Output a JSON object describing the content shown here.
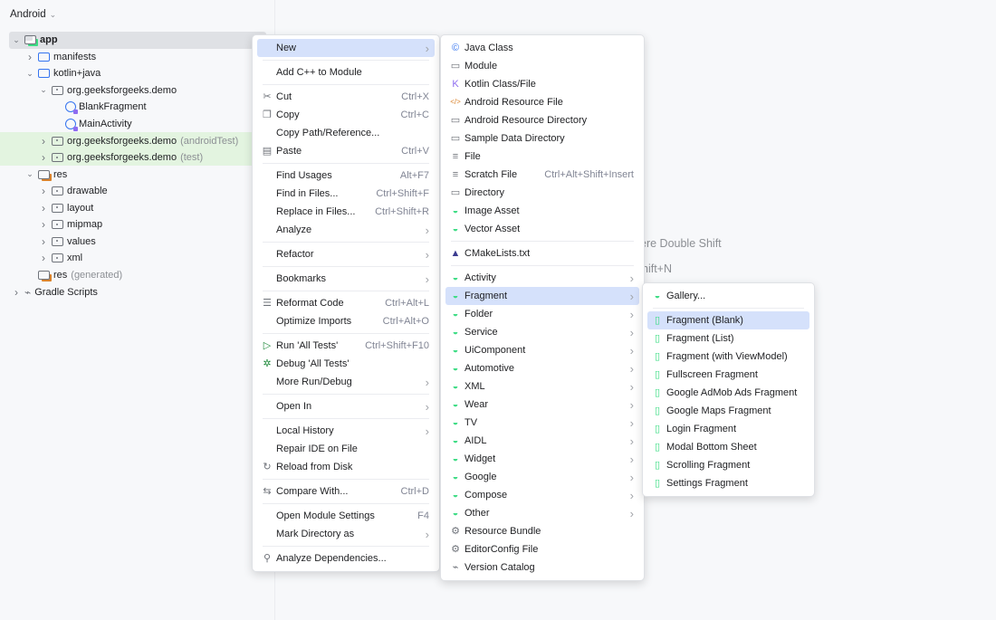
{
  "project_view": {
    "selector": "Android",
    "tree": [
      {
        "label": "app",
        "depth": 0,
        "arrow": "open",
        "icon": "module-folder-icon",
        "selected": true
      },
      {
        "label": "manifests",
        "depth": 1,
        "arrow": "closed",
        "icon": "folder-icon"
      },
      {
        "label": "kotlin+java",
        "depth": 1,
        "arrow": "open",
        "icon": "folder-icon"
      },
      {
        "label": "org.geeksforgeeks.demo",
        "depth": 2,
        "arrow": "open",
        "icon": "package-icon"
      },
      {
        "label": "BlankFragment",
        "depth": 3,
        "arrow": "none",
        "icon": "kotlin-class-icon"
      },
      {
        "label": "MainActivity",
        "depth": 3,
        "arrow": "none",
        "icon": "kotlin-class-icon"
      },
      {
        "label": "org.geeksforgeeks.demo",
        "suffix": "(androidTest)",
        "depth": 2,
        "arrow": "closed",
        "icon": "package-icon",
        "green": true
      },
      {
        "label": "org.geeksforgeeks.demo",
        "suffix": "(test)",
        "depth": 2,
        "arrow": "closed",
        "icon": "package-icon",
        "green": true
      },
      {
        "label": "res",
        "depth": 1,
        "arrow": "open",
        "icon": "res-folder-icon"
      },
      {
        "label": "drawable",
        "depth": 2,
        "arrow": "closed",
        "icon": "package-icon"
      },
      {
        "label": "layout",
        "depth": 2,
        "arrow": "closed",
        "icon": "package-icon"
      },
      {
        "label": "mipmap",
        "depth": 2,
        "arrow": "closed",
        "icon": "package-icon"
      },
      {
        "label": "values",
        "depth": 2,
        "arrow": "closed",
        "icon": "package-icon"
      },
      {
        "label": "xml",
        "depth": 2,
        "arrow": "closed",
        "icon": "package-icon"
      },
      {
        "label": "res",
        "suffix": "(generated)",
        "depth": 1,
        "arrow": "none",
        "icon": "res-folder-icon"
      },
      {
        "label": "Gradle Scripts",
        "depth": 0,
        "arrow": "closed",
        "icon": "gradle-icon"
      }
    ]
  },
  "hints": [
    "ere Double Shift",
    "hift+N"
  ],
  "context_menu": [
    {
      "label": "New",
      "sub": true,
      "hl": true
    },
    "-",
    {
      "label": "Add C++ to Module"
    },
    "-",
    {
      "label": "Cut",
      "sc": "Ctrl+X",
      "icon": "scissors-icon",
      "g": "✂"
    },
    {
      "label": "Copy",
      "sc": "Ctrl+C",
      "icon": "copy-icon",
      "g": "❐"
    },
    {
      "label": "Copy Path/Reference..."
    },
    {
      "label": "Paste",
      "sc": "Ctrl+V",
      "icon": "paste-icon",
      "g": "▤"
    },
    "-",
    {
      "label": "Find Usages",
      "sc": "Alt+F7"
    },
    {
      "label": "Find in Files...",
      "sc": "Ctrl+Shift+F"
    },
    {
      "label": "Replace in Files...",
      "sc": "Ctrl+Shift+R"
    },
    {
      "label": "Analyze",
      "sub": true
    },
    "-",
    {
      "label": "Refactor",
      "sub": true
    },
    "-",
    {
      "label": "Bookmarks",
      "sub": true
    },
    "-",
    {
      "label": "Reformat Code",
      "sc": "Ctrl+Alt+L",
      "icon": "reformat-icon",
      "g": "☰"
    },
    {
      "label": "Optimize Imports",
      "sc": "Ctrl+Alt+O"
    },
    "-",
    {
      "label": "Run 'All Tests'",
      "sc": "Ctrl+Shift+F10",
      "icon": "run-icon",
      "g": "▷",
      "c": "#208a3c"
    },
    {
      "label": "Debug 'All Tests'",
      "icon": "debug-icon",
      "g": "✲",
      "c": "#208a3c"
    },
    {
      "label": "More Run/Debug",
      "sub": true
    },
    "-",
    {
      "label": "Open In",
      "sub": true
    },
    "-",
    {
      "label": "Local History",
      "sub": true
    },
    {
      "label": "Repair IDE on File"
    },
    {
      "label": "Reload from Disk",
      "icon": "reload-icon",
      "g": "↻"
    },
    "-",
    {
      "label": "Compare With...",
      "sc": "Ctrl+D",
      "icon": "compare-icon",
      "g": "⇆"
    },
    "-",
    {
      "label": "Open Module Settings",
      "sc": "F4"
    },
    {
      "label": "Mark Directory as",
      "sub": true
    },
    "-",
    {
      "label": "Analyze Dependencies...",
      "icon": "dependencies-icon",
      "g": "⚲"
    }
  ],
  "new_menu": [
    {
      "label": "Java Class",
      "icon": "java-class-icon",
      "g": "©",
      "c": "#3574f0"
    },
    {
      "label": "Module",
      "icon": "module-icon",
      "g": "▭"
    },
    {
      "label": "Kotlin Class/File",
      "icon": "kotlin-icon",
      "g": "K",
      "c": "#8e6cf0"
    },
    {
      "label": "Android Resource File",
      "icon": "xml-file-icon",
      "g": "</>",
      "c": "#d9822b"
    },
    {
      "label": "Android Resource Directory",
      "icon": "folder-icon",
      "g": "▭"
    },
    {
      "label": "Sample Data Directory",
      "icon": "folder-icon",
      "g": "▭"
    },
    {
      "label": "File",
      "icon": "file-icon",
      "g": "≡"
    },
    {
      "label": "Scratch File",
      "sc": "Ctrl+Alt+Shift+Insert",
      "icon": "scratch-file-icon",
      "g": "≡"
    },
    {
      "label": "Directory",
      "icon": "folder-icon",
      "g": "▭"
    },
    {
      "label": "Image Asset",
      "icon": "android-icon",
      "g": "◒",
      "c": "#3ddc84"
    },
    {
      "label": "Vector Asset",
      "icon": "android-icon",
      "g": "◒",
      "c": "#3ddc84"
    },
    "-",
    {
      "label": "CMakeLists.txt",
      "icon": "cmake-icon",
      "g": "▲",
      "c": "#3b3b8f"
    },
    "-",
    {
      "label": "Activity",
      "sub": true,
      "icon": "android-icon",
      "g": "◒",
      "c": "#3ddc84"
    },
    {
      "label": "Fragment",
      "sub": true,
      "hl": true,
      "icon": "android-icon",
      "g": "◒",
      "c": "#3ddc84"
    },
    {
      "label": "Folder",
      "sub": true,
      "icon": "android-icon",
      "g": "◒",
      "c": "#3ddc84"
    },
    {
      "label": "Service",
      "sub": true,
      "icon": "android-icon",
      "g": "◒",
      "c": "#3ddc84"
    },
    {
      "label": "UiComponent",
      "sub": true,
      "icon": "android-icon",
      "g": "◒",
      "c": "#3ddc84"
    },
    {
      "label": "Automotive",
      "sub": true,
      "icon": "android-icon",
      "g": "◒",
      "c": "#3ddc84"
    },
    {
      "label": "XML",
      "sub": true,
      "icon": "android-icon",
      "g": "◒",
      "c": "#3ddc84"
    },
    {
      "label": "Wear",
      "sub": true,
      "icon": "android-icon",
      "g": "◒",
      "c": "#3ddc84"
    },
    {
      "label": "TV",
      "sub": true,
      "icon": "android-icon",
      "g": "◒",
      "c": "#3ddc84"
    },
    {
      "label": "AIDL",
      "sub": true,
      "icon": "android-icon",
      "g": "◒",
      "c": "#3ddc84"
    },
    {
      "label": "Widget",
      "sub": true,
      "icon": "android-icon",
      "g": "◒",
      "c": "#3ddc84"
    },
    {
      "label": "Google",
      "sub": true,
      "icon": "android-icon",
      "g": "◒",
      "c": "#3ddc84"
    },
    {
      "label": "Compose",
      "sub": true,
      "icon": "android-icon",
      "g": "◒",
      "c": "#3ddc84"
    },
    {
      "label": "Other",
      "sub": true,
      "icon": "android-icon",
      "g": "◒",
      "c": "#3ddc84"
    },
    {
      "label": "Resource Bundle",
      "icon": "gear-icon",
      "g": "⚙"
    },
    {
      "label": "EditorConfig File",
      "icon": "gear-icon",
      "g": "⚙"
    },
    {
      "label": "Version Catalog",
      "icon": "gradle-icon",
      "g": "⌁"
    }
  ],
  "fragment_menu": [
    {
      "label": "Gallery...",
      "icon": "android-icon",
      "g": "◒",
      "c": "#3ddc84"
    },
    "-",
    {
      "label": "Fragment (Blank)",
      "hl": true,
      "icon": "fragment-template-icon",
      "g": "▯",
      "c": "#3ddc84"
    },
    {
      "label": "Fragment (List)",
      "icon": "fragment-template-icon",
      "g": "▯",
      "c": "#3ddc84"
    },
    {
      "label": "Fragment (with ViewModel)",
      "icon": "fragment-template-icon",
      "g": "▯",
      "c": "#3ddc84"
    },
    {
      "label": "Fullscreen Fragment",
      "icon": "fragment-template-icon",
      "g": "▯",
      "c": "#3ddc84"
    },
    {
      "label": "Google AdMob Ads Fragment",
      "icon": "fragment-template-icon",
      "g": "▯",
      "c": "#3ddc84"
    },
    {
      "label": "Google Maps Fragment",
      "icon": "fragment-template-icon",
      "g": "▯",
      "c": "#3ddc84"
    },
    {
      "label": "Login Fragment",
      "icon": "fragment-template-icon",
      "g": "▯",
      "c": "#3ddc84"
    },
    {
      "label": "Modal Bottom Sheet",
      "icon": "fragment-template-icon",
      "g": "▯",
      "c": "#3ddc84"
    },
    {
      "label": "Scrolling Fragment",
      "icon": "fragment-template-icon",
      "g": "▯",
      "c": "#3ddc84"
    },
    {
      "label": "Settings Fragment",
      "icon": "fragment-template-icon",
      "g": "▯",
      "c": "#3ddc84"
    }
  ]
}
